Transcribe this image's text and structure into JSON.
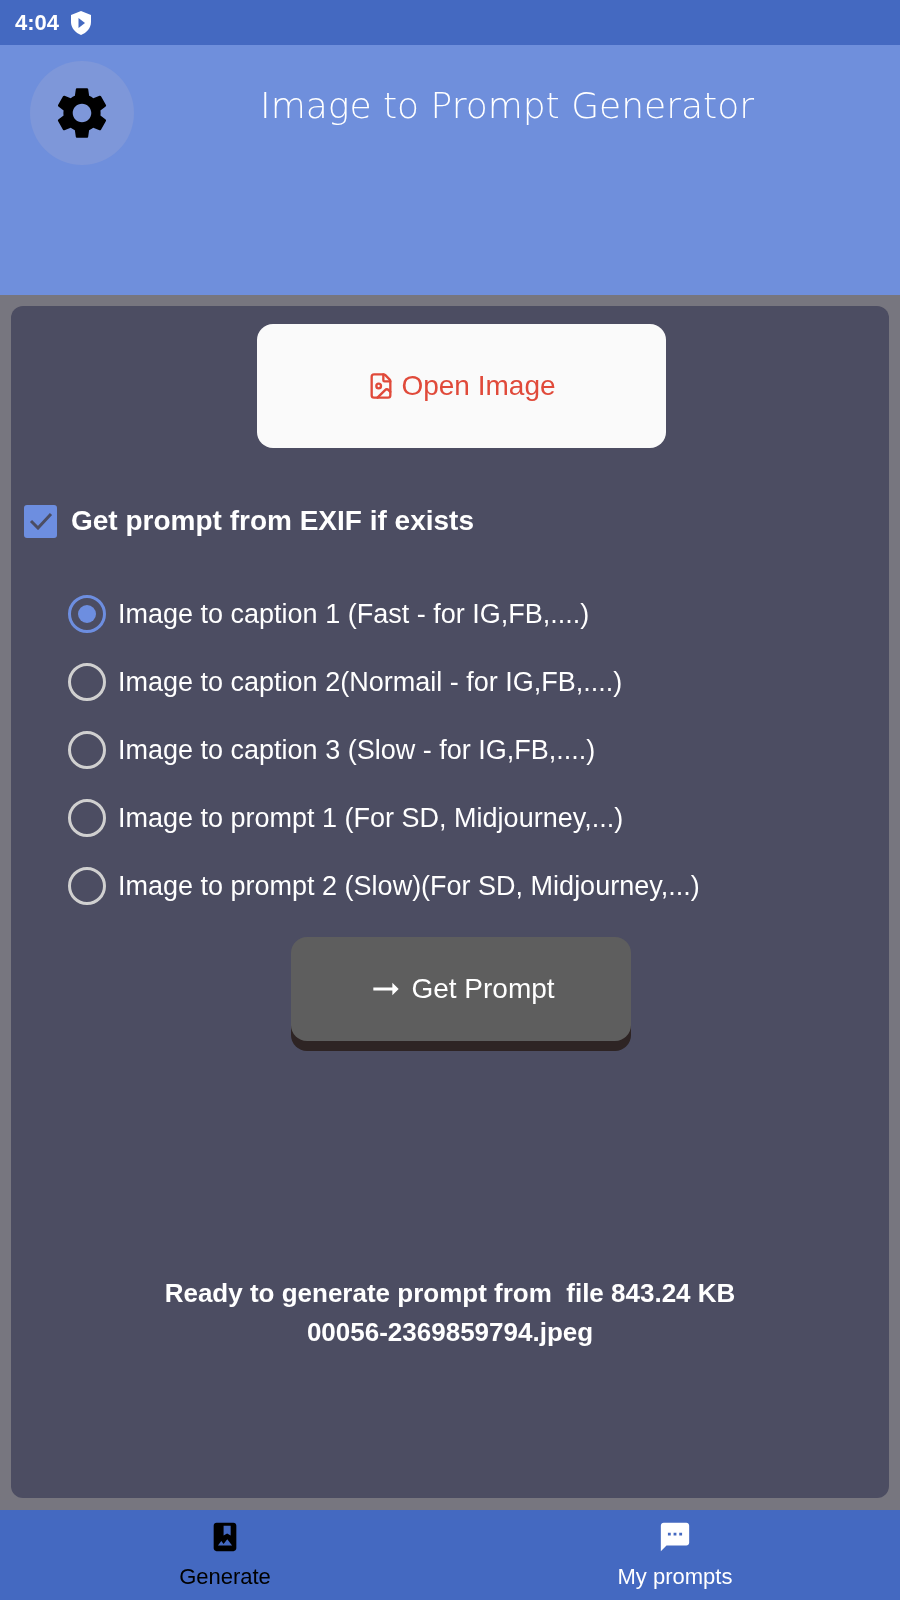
{
  "status_bar": {
    "time": "4:04"
  },
  "header": {
    "title": "Image to Prompt Generator"
  },
  "open_button": {
    "label": "Open Image"
  },
  "exif_option": {
    "label": "Get prompt from EXIF if exists",
    "checked": true
  },
  "modes": [
    {
      "label": "Image to caption 1 (Fast - for IG,FB,....)",
      "selected": true
    },
    {
      "label": "Image to caption 2(Normail - for IG,FB,....)",
      "selected": false
    },
    {
      "label": "Image to caption 3 (Slow - for IG,FB,....)",
      "selected": false
    },
    {
      "label": "Image to prompt 1 (For SD, Midjourney,...)",
      "selected": false
    },
    {
      "label": "Image to prompt 2 (Slow)(For SD, Midjourney,...)",
      "selected": false
    }
  ],
  "get_prompt_button": {
    "label": "Get Prompt"
  },
  "status_message": {
    "lines": [
      "Ready to generate prompt from  file 843.24 KB",
      "00056-2369859794.jpeg"
    ]
  },
  "bottom_nav": [
    {
      "label": "Generate",
      "kind": "album",
      "selected": true
    },
    {
      "label": "My prompts",
      "kind": "chat",
      "selected": false
    }
  ]
}
